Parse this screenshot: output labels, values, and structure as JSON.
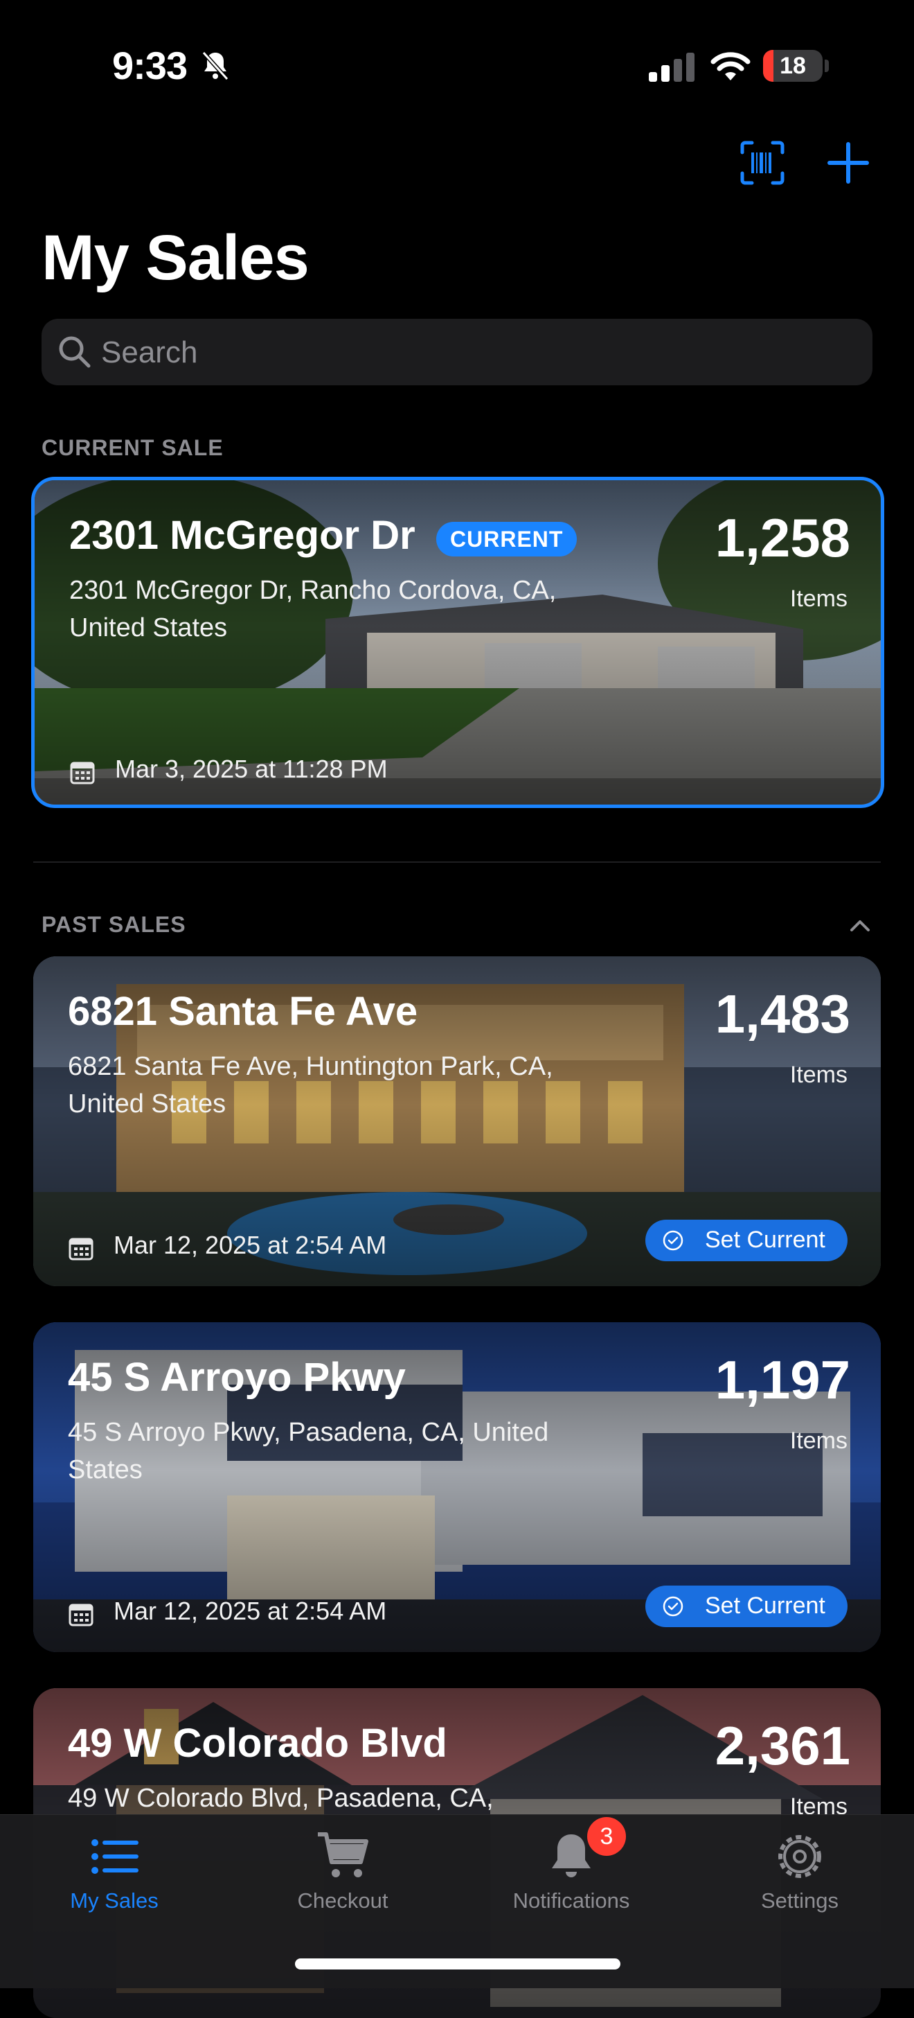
{
  "status_bar": {
    "time": "9:33",
    "battery": "18",
    "battery_level": 0.18
  },
  "page": {
    "title": "My Sales",
    "search_placeholder": "Search"
  },
  "sections": {
    "current": "CURRENT SALE",
    "past": "PAST SALES"
  },
  "current_sale": {
    "title": "2301 McGregor Dr",
    "badge": "CURRENT",
    "address": "2301 McGregor Dr, Rancho Cordova, CA, United States",
    "count": "1,258",
    "count_label": "Items",
    "date": "Mar 3, 2025 at 11:28 PM"
  },
  "past_sales": [
    {
      "title": "6821 Santa Fe Ave",
      "address": "6821 Santa Fe Ave, Huntington Park, CA, United States",
      "count": "1,483",
      "count_label": "Items",
      "date": "Mar 12, 2025 at 2:54 AM",
      "action": "Set Current"
    },
    {
      "title": "45 S Arroyo Pkwy",
      "address": "45 S Arroyo Pkwy, Pasadena, CA, United States",
      "count": "1,197",
      "count_label": "Items",
      "date": "Mar 12, 2025 at 2:54 AM",
      "action": "Set Current"
    },
    {
      "title": "49 W Colorado Blvd",
      "address": "49 W Colorado Blvd, Pasadena, CA,",
      "count": "2,361",
      "count_label": "Items"
    }
  ],
  "tabs": [
    {
      "label": "My Sales",
      "icon": "list-icon",
      "active": true
    },
    {
      "label": "Checkout",
      "icon": "cart-icon"
    },
    {
      "label": "Notifications",
      "icon": "bell-icon",
      "badge": "3"
    },
    {
      "label": "Settings",
      "icon": "gear-icon"
    }
  ],
  "colors": {
    "accent": "#1a84ff",
    "badge_red": "#ff3b30",
    "background": "#000000"
  }
}
